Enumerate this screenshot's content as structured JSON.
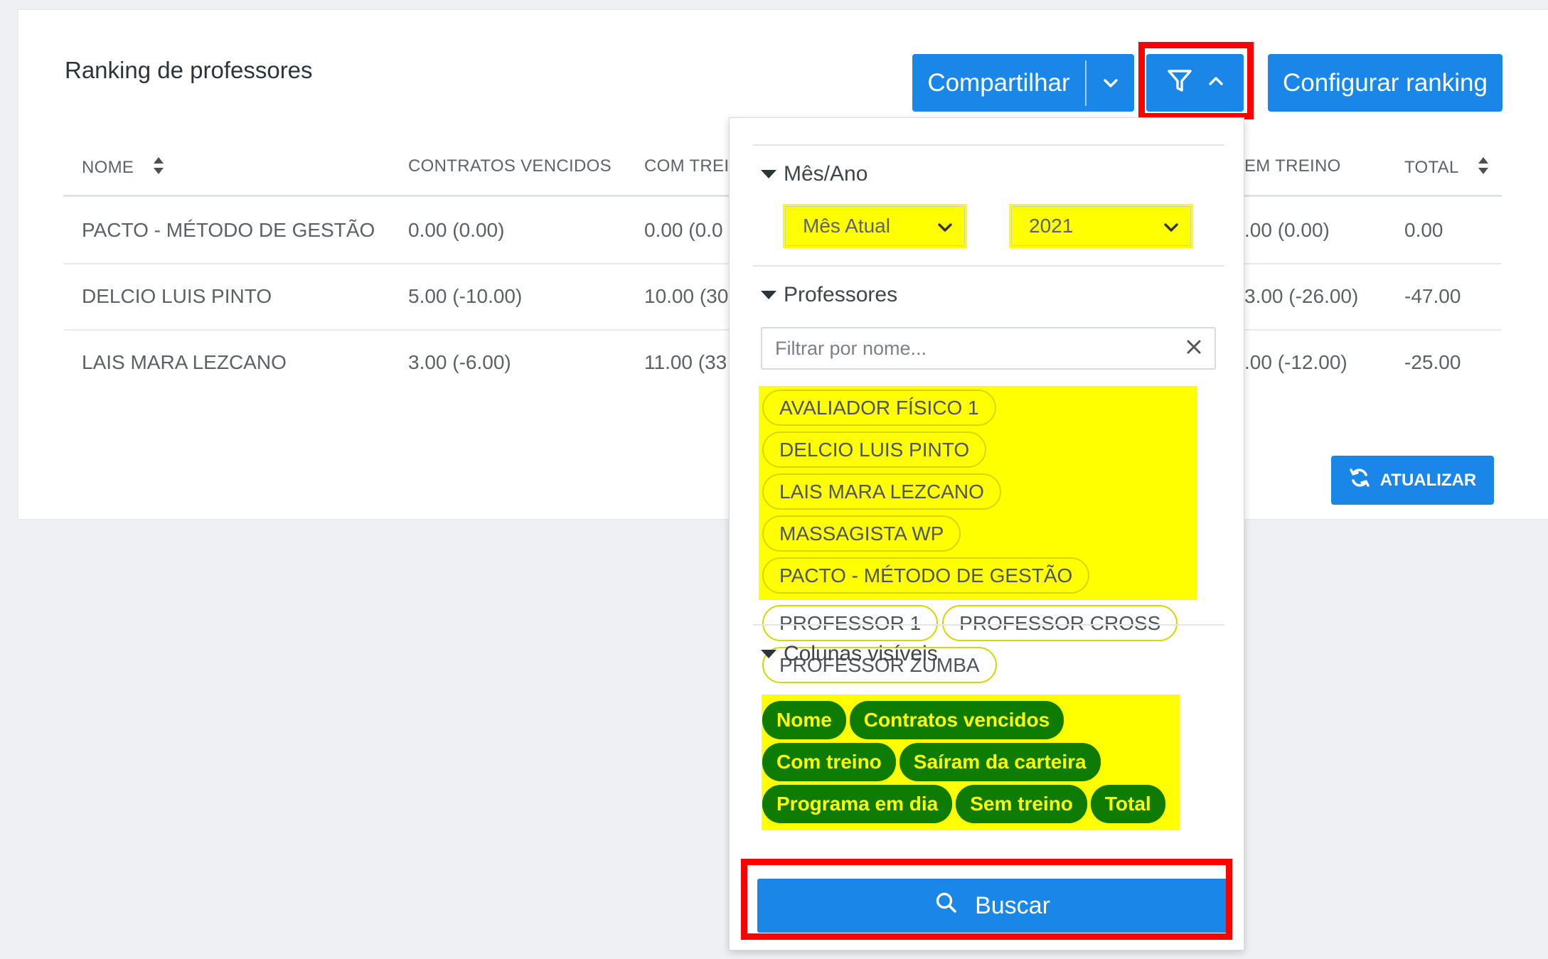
{
  "page": {
    "title": "Ranking de professores"
  },
  "toolbar": {
    "share_label": "Compartilhar",
    "config_label": "Configurar ranking",
    "refresh_label": "ATUALIZAR"
  },
  "table": {
    "headers": [
      "NOME",
      "CONTRATOS VENCIDOS",
      "COM TREI",
      "EM TREINO",
      "TOTAL"
    ],
    "rows": [
      {
        "nome": "PACTO - MÉTODO DE GESTÃO",
        "contratos": "0.00 (0.00)",
        "com_treino": "0.00 (0.0",
        "sem_treino": ".00 (0.00)",
        "total": "0.00"
      },
      {
        "nome": "DELCIO LUIS PINTO",
        "contratos": "5.00 (-10.00)",
        "com_treino": "10.00 (30",
        "sem_treino": "3.00 (-26.00)",
        "total": "-47.00"
      },
      {
        "nome": "LAIS MARA LEZCANO",
        "contratos": "3.00 (-6.00)",
        "com_treino": "11.00 (33",
        "sem_treino": ".00 (-12.00)",
        "total": "-25.00"
      }
    ]
  },
  "filter": {
    "month_year_title": "Mês/Ano",
    "month_value": "Mês Atual",
    "year_value": "2021",
    "teachers_title": "Professores",
    "search_placeholder": "Filtrar por nome...",
    "teachers": [
      "AVALIADOR FÍSICO 1",
      "DELCIO LUIS PINTO",
      "LAIS MARA LEZCANO",
      "MASSAGISTA WP",
      "PACTO - MÉTODO DE GESTÃO",
      "PROFESSOR 1",
      "PROFESSOR CROSS",
      "PROFESSOR ZUMBA"
    ],
    "columns_title": "Colunas visíveis",
    "columns": [
      "Nome",
      "Contratos vencidos",
      "Com treino",
      "Saíram da carteira",
      "Programa em dia",
      "Sem treino",
      "Total"
    ],
    "search_button": "Buscar"
  },
  "colors": {
    "primary": "#1a86e8",
    "highlight_yellow": "#ffff00",
    "highlight_red": "#ff0000",
    "chip_green": "#0d7c00"
  }
}
